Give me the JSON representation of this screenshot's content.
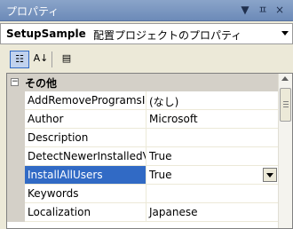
{
  "window": {
    "title": "プロパティ",
    "dropdown_icon": "▼",
    "pin_icon": "ㅍ",
    "close_icon": "×"
  },
  "object_selector": {
    "name": "SetupSample",
    "type": "配置プロジェクトのプロパティ"
  },
  "toolbar": {
    "buttons": [
      {
        "icon": "categorized-icon",
        "glyph": "☷",
        "active": true
      },
      {
        "icon": "alphabetical-icon",
        "glyph": "A↓",
        "active": false
      },
      {
        "icon": "property-pages-icon",
        "glyph": "▤",
        "active": false
      }
    ]
  },
  "grid": {
    "category": {
      "label": "その他",
      "expander": "−"
    },
    "rows": [
      {
        "name": "AddRemoveProgramsIcon",
        "value": "(なし)"
      },
      {
        "name": "Author",
        "value": "Microsoft"
      },
      {
        "name": "Description",
        "value": ""
      },
      {
        "name": "DetectNewerInstalledVersion",
        "value": "True"
      },
      {
        "name": "InstallAllUsers",
        "value": "True"
      },
      {
        "name": "Keywords",
        "value": ""
      },
      {
        "name": "Localization",
        "value": "Japanese"
      }
    ],
    "selected_row": "InstallAllUsers",
    "accent_color": "#316ac5"
  }
}
